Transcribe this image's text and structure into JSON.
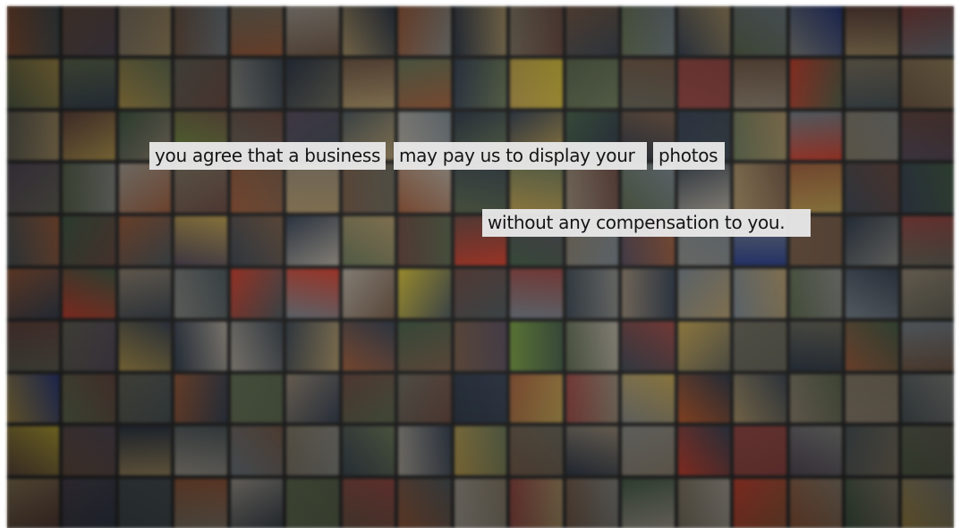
{
  "captions": {
    "line1_part1": "you agree that a business",
    "line1_part2": "may pay us to display your",
    "line1_part3": "photos",
    "line2": "without any compensation to you."
  },
  "mosaic": {
    "description_icon": "photo-grid",
    "palette": [
      "#6b6a5c",
      "#7a5e4a",
      "#4e5a5e",
      "#8a7f6a",
      "#5d6b4f",
      "#9a8c78",
      "#6e4b43",
      "#3f4a55",
      "#b39b6c",
      "#7c8891",
      "#5a4f60",
      "#a6613e",
      "#47624a",
      "#8d8f8a",
      "#c4a552",
      "#384456",
      "#9e4a46",
      "#6f7d5c",
      "#b7b0a3",
      "#2f3a4a"
    ],
    "accent_colors": [
      "#d8c23a",
      "#d9432f",
      "#2b3f8c",
      "#c75e2a",
      "#7aa045"
    ]
  }
}
